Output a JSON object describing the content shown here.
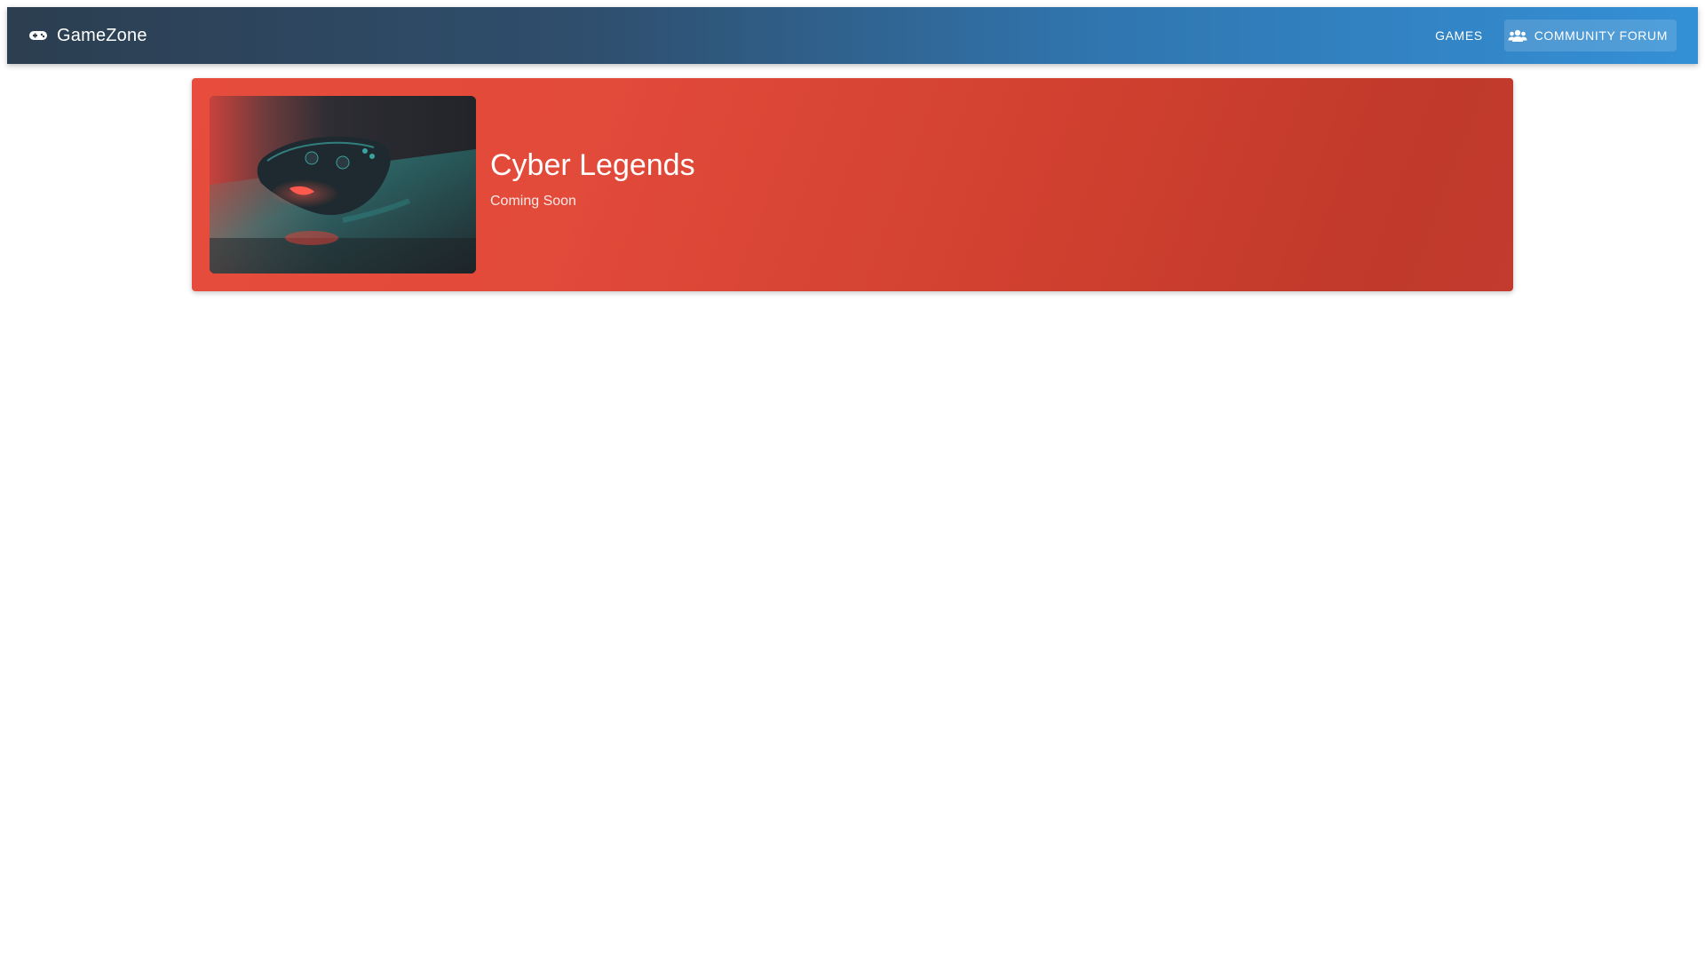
{
  "navbar": {
    "brand": {
      "label": "GameZone",
      "icon": "gamepad-icon"
    },
    "links": [
      {
        "label": "GAMES",
        "active": false
      },
      {
        "label": "COMMUNITY FORUM",
        "icon": "users-icon",
        "active": true
      }
    ],
    "colors": {
      "gradient_start": "#2c3e50",
      "gradient_end": "#3490d6"
    }
  },
  "banner": {
    "title": "Cyber Legends",
    "status": "Coming Soon",
    "image": "game-controller-photo",
    "colors": {
      "gradient_start": "#e74c3c",
      "gradient_end": "#c0392b"
    }
  }
}
